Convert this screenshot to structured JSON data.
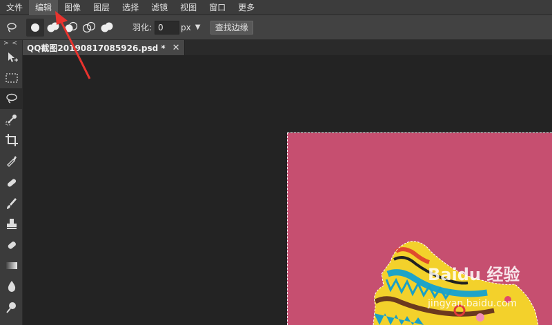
{
  "menu": [
    "文件",
    "编辑",
    "图像",
    "图层",
    "选择",
    "滤镜",
    "视图",
    "窗口",
    "更多"
  ],
  "menu_active_index": 1,
  "options": {
    "feather_label": "羽化:",
    "feather_value": "0",
    "feather_unit": "px",
    "refine_button": "查找边缘"
  },
  "toolbar": {
    "collapse_glyph": "> <"
  },
  "document": {
    "tab_title": "QQ截图20190817085926.psd *",
    "close_glyph": "✕"
  },
  "colors": {
    "canvas_fill": "#c64f70",
    "annotation_arrow": "#e8332e"
  },
  "watermark": {
    "brand": "Baidu 经验",
    "sub": "jingyan.baidu.com"
  }
}
